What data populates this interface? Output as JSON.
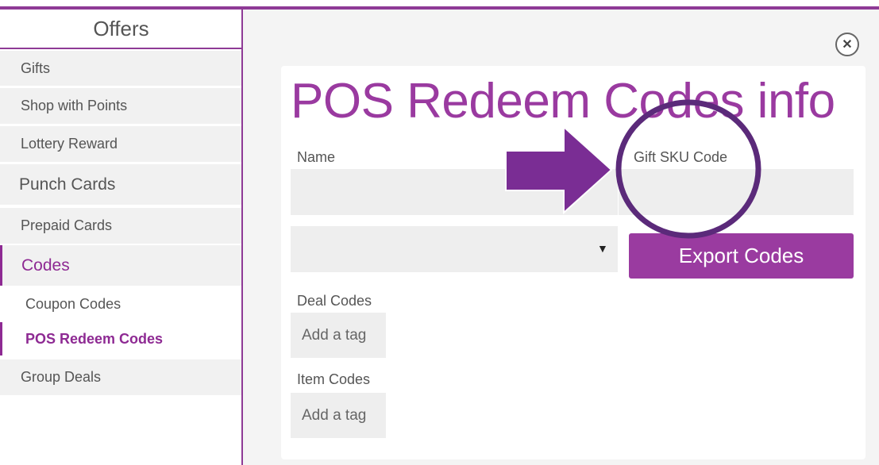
{
  "sidebar": {
    "header": "Offers",
    "items": [
      {
        "label": "Gifts"
      },
      {
        "label": "Shop with Points"
      },
      {
        "label": "Lottery Reward"
      },
      {
        "label": "Punch Cards"
      },
      {
        "label": "Prepaid Cards"
      },
      {
        "label": "Codes"
      },
      {
        "label": "Coupon Codes"
      },
      {
        "label": "POS Redeem Codes"
      },
      {
        "label": "Group Deals"
      }
    ]
  },
  "main": {
    "title": "POS Redeem Codes info",
    "name_label": "Name",
    "gift_sku_label": "Gift SKU Code",
    "export_button": "Export Codes",
    "deal_codes_label": "Deal Codes",
    "deal_codes_placeholder": "Add a tag",
    "item_codes_label": "Item Codes",
    "item_codes_placeholder": "Add a tag",
    "select_arrow": "▼",
    "close_icon_glyph": "✕"
  },
  "colors": {
    "accent": "#8e3a96",
    "annotation": "#6a2a8a"
  }
}
